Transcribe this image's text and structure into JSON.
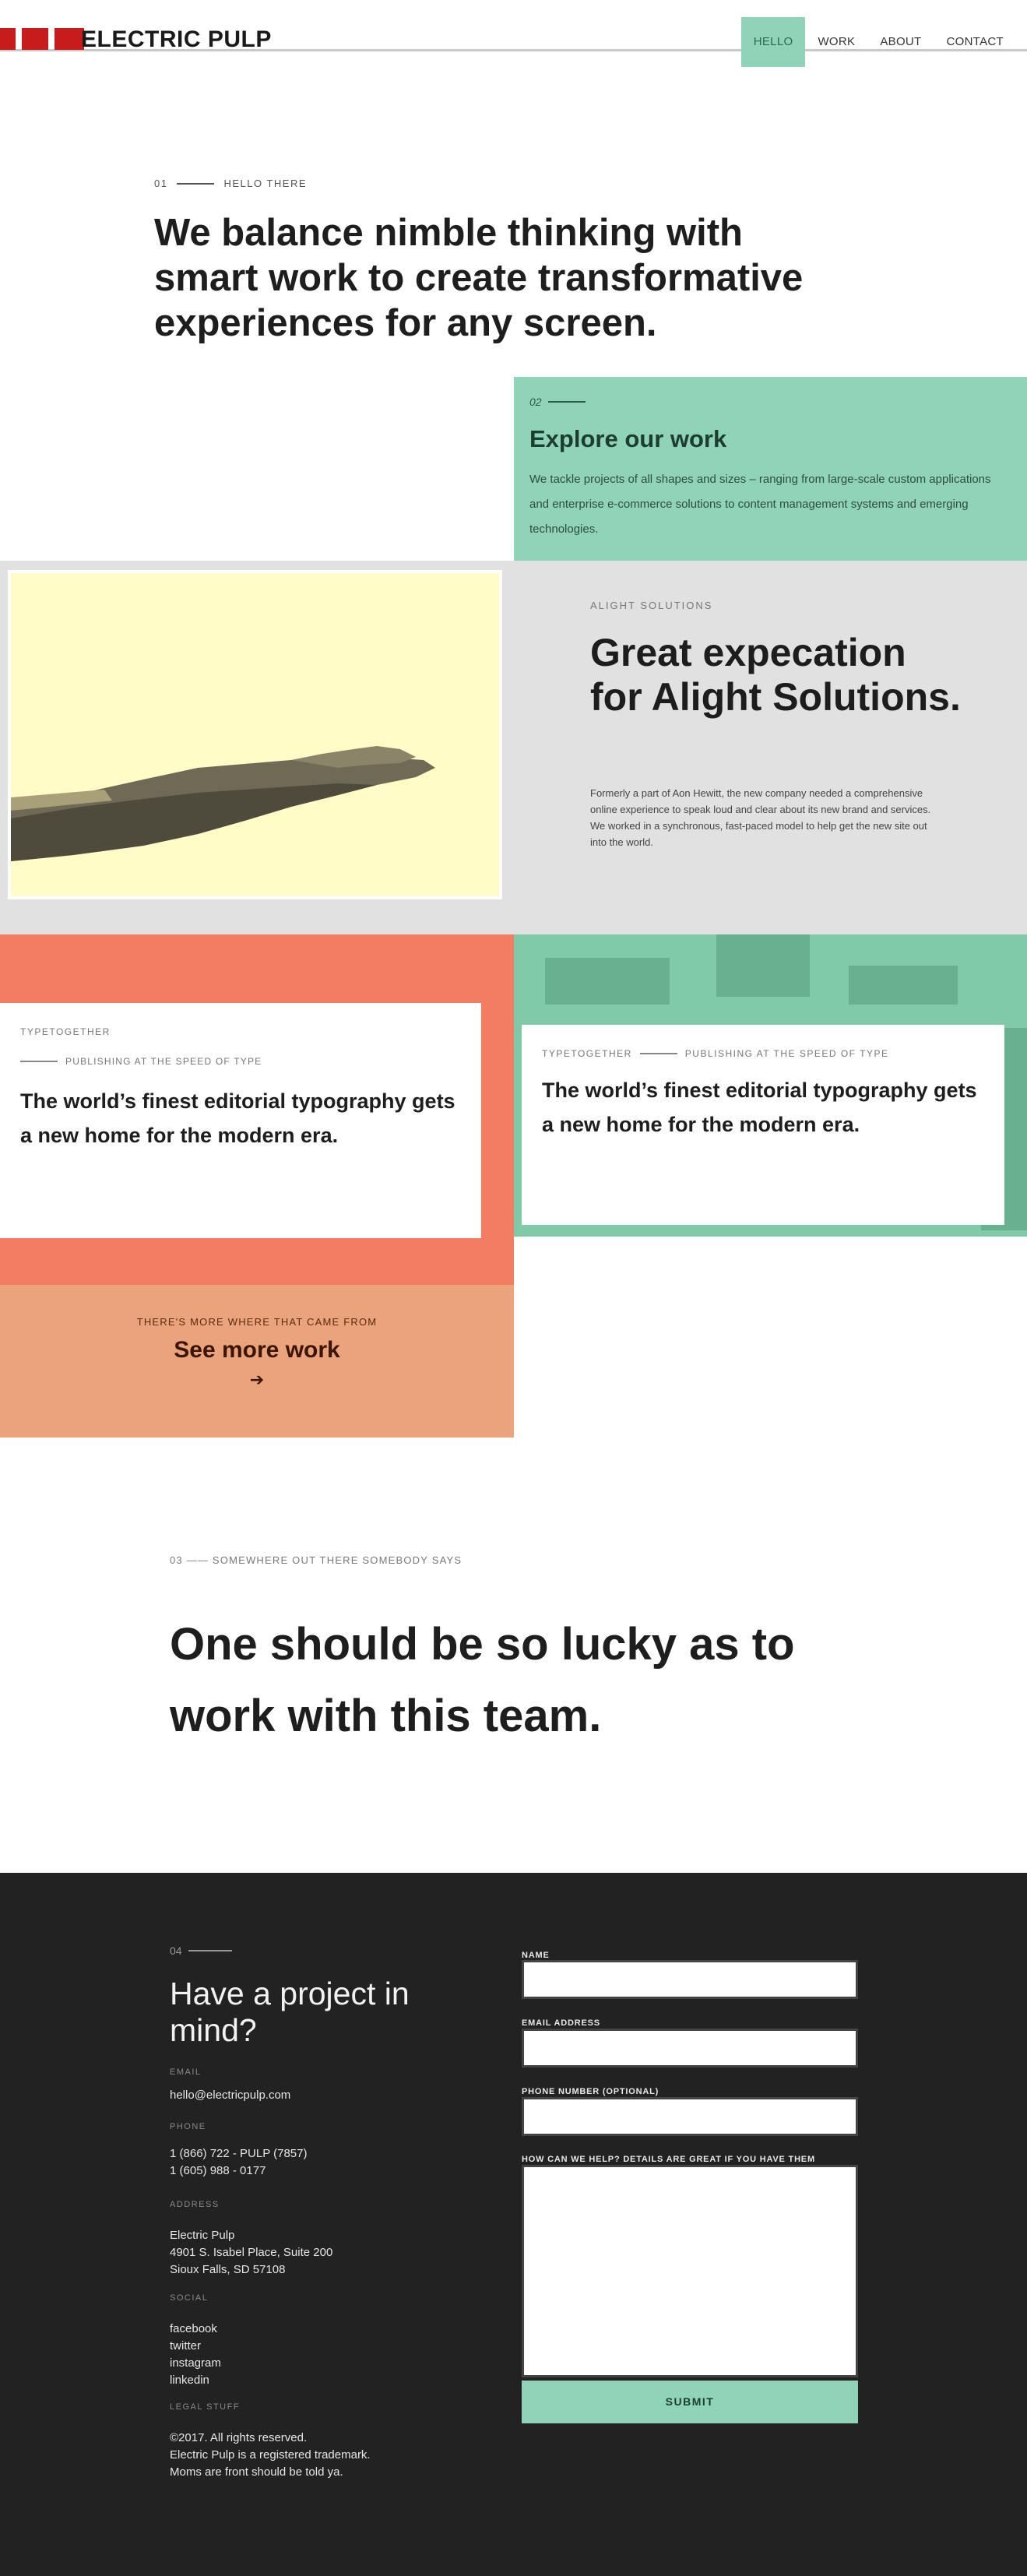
{
  "header": {
    "logo": "ELECTRIC PULP",
    "nav": [
      "HELLO",
      "WORK",
      "ABOUT",
      "CONTACT"
    ],
    "active_nav": "HELLO"
  },
  "intro": {
    "number": "01",
    "eyebrow": "HELLO THERE",
    "title": "We balance nimble thinking with smart work to create transformative experiences for any screen."
  },
  "explore": {
    "number": "02",
    "title": "Explore our work",
    "body": "We tackle projects of all shapes and sizes – ranging from large-scale custom applications and enterprise e-commerce solutions to content management systems and emerging technologies."
  },
  "feature": {
    "eyebrow": "ALIGHT SOLUTIONS",
    "title": "Great expecation for Alight Solutions.",
    "body": "Formerly a part of Aon Hewitt, the new company needed a comprehensive online experience to speak loud and clear about its new brand and services. We worked in a synchronous, fast-paced model to help get the new site out into the world."
  },
  "cards": [
    {
      "category": "TYPETOGETHER",
      "subtitle": "PUBLISHING AT THE SPEED OF TYPE",
      "title": "The world’s finest editorial typography gets a new home for the modern era."
    },
    {
      "category": "TYPETOGETHER",
      "subtitle": "PUBLISHING AT THE SPEED OF TYPE",
      "title": "The world’s finest editorial typography gets a new home for the modern era."
    }
  ],
  "more": {
    "kicker": "THERE'S MORE WHERE THAT CAME FROM",
    "cta": "See more work",
    "arrow": "➔"
  },
  "testimonial": {
    "eyebrow": "03 —— SOMEWHERE OUT THERE SOMEBODY SAYS",
    "quote": "One should be so lucky as to work with this team."
  },
  "footer": {
    "number": "04",
    "title": "Have a project in mind?",
    "email_label": "EMAIL",
    "email": "hello@electricpulp.com",
    "phone_label": "PHONE",
    "phone_1": "1 (866) 722 - PULP (7857)",
    "phone_2": "1 (605) 988 - 0177",
    "address_label": "ADDRESS",
    "address_1": "Electric Pulp",
    "address_2": "4901 S. Isabel Place, Suite 200",
    "address_3": "Sioux Falls, SD 57108",
    "social_label": "SOCIAL",
    "social": [
      "facebook",
      "twitter",
      "instagram",
      "linkedin"
    ],
    "legal_label": "LEGAL STUFF",
    "legal_1": "©2017. All rights reserved.",
    "legal_2": "Electric Pulp is a registered trademark.",
    "legal_3": "Moms are front should be told ya."
  },
  "form": {
    "name_label": "NAME",
    "email_label": "EMAIL ADDRESS",
    "phone_label": "PHONE NUMBER (OPTIONAL)",
    "message_label": "HOW CAN WE HELP? DETAILS ARE GREAT IF YOU HAVE THEM",
    "submit": "SUBMIT"
  },
  "colors": {
    "accent_mint": "#8fd3b9",
    "accent_coral": "#f27d62",
    "accent_peach": "#eaa37a",
    "brand_red": "#c61c1c",
    "footer_bg": "#222222"
  }
}
